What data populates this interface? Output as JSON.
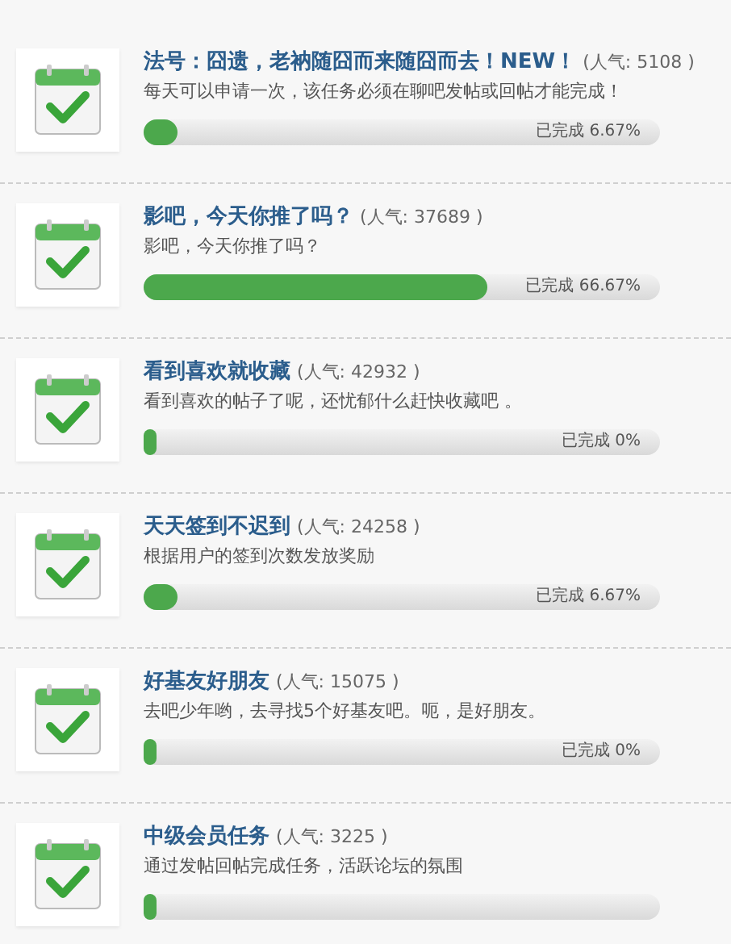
{
  "tasks": [
    {
      "title": "法号：囧遗，老衲随囧而来随囧而去！NEW！",
      "popularity": "(人气: 5108 )",
      "description": "每天可以申请一次，该任务必须在聊吧发帖或回帖才能完成！",
      "level": 0.0667,
      "progress": "已完成 6.67%"
    },
    {
      "title": "影吧，今天你推了吗？",
      "popularity": "(人气: 37689 )",
      "description": "影吧，今天你推了吗？",
      "level": 0.6667,
      "progress": "已完成 66.67%"
    },
    {
      "title": "看到喜欢就收藏",
      "popularity": "(人气: 42932 )",
      "description": "看到喜欢的帖子了呢，还忧郁什么赶快收藏吧 。",
      "level": 0,
      "progress": "已完成 0%"
    },
    {
      "title": "天天签到不迟到",
      "popularity": "(人气: 24258 )",
      "description": "根据用户的签到次数发放奖励",
      "level": 0.0667,
      "progress": "已完成 6.67%"
    },
    {
      "title": "好基友好朋友",
      "popularity": "(人气: 15075 )",
      "description": "去吧少年哟，去寻找5个好基友吧。呃，是好朋友。",
      "level": 0,
      "progress": "已完成 0%"
    },
    {
      "title": "中级会员任务",
      "popularity": "(人气: 3225 )",
      "description": "通过发帖回帖完成任务，活跃论坛的氛围",
      "level": 0
    }
  ]
}
